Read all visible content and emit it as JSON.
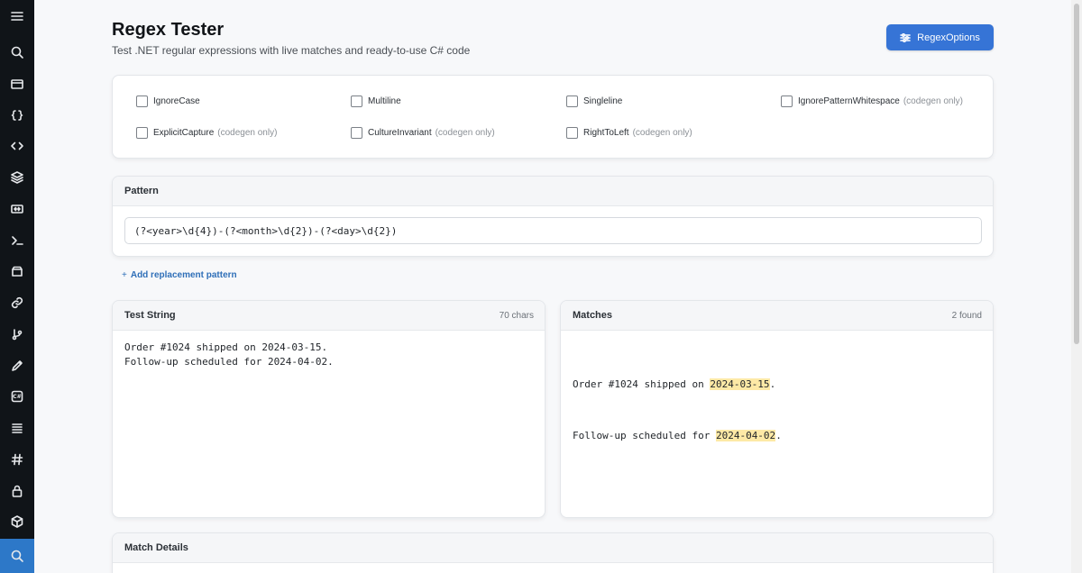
{
  "sidebar": {
    "icons": [
      "menu-icon",
      "search-icon",
      "credit-card-icon",
      "braces-icon",
      "code-icon",
      "layers-icon",
      "compare-icon",
      "terminal-icon",
      "archive-icon",
      "link-icon",
      "git-icon",
      "pen-icon",
      "csharp-icon",
      "list-icon",
      "hash-icon",
      "lock-icon",
      "package-icon",
      "search-active-icon"
    ],
    "csharp_label": "C#",
    "active": "search-active-icon"
  },
  "header": {
    "title": "Regex Tester",
    "subtitle": "Test .NET regular expressions with live matches and ready-to-use C# code",
    "options_button": "RegexOptions"
  },
  "options": {
    "items": [
      {
        "label": "IgnoreCase",
        "note": "",
        "checked": false
      },
      {
        "label": "Multiline",
        "note": "",
        "checked": false
      },
      {
        "label": "Singleline",
        "note": "",
        "checked": false
      },
      {
        "label": "IgnorePatternWhitespace",
        "note": "(codegen only)",
        "checked": false
      },
      {
        "label": "ExplicitCapture",
        "note": "(codegen only)",
        "checked": false
      },
      {
        "label": "CultureInvariant",
        "note": "(codegen only)",
        "checked": false
      },
      {
        "label": "RightToLeft",
        "note": "(codegen only)",
        "checked": false
      }
    ]
  },
  "pattern": {
    "heading": "Pattern",
    "value": "(?<year>\\d{4})-(?<month>\\d{2})-(?<day>\\d{2})"
  },
  "add_replacement": {
    "plus": "+",
    "label": "Add replacement pattern"
  },
  "test_string": {
    "heading": "Test String",
    "count": "70 chars",
    "lines": [
      "Order #1024 shipped on 2024-03-15.",
      "Follow-up scheduled for 2024-04-02."
    ]
  },
  "matches": {
    "heading": "Matches",
    "count": "2 found",
    "lines": [
      {
        "before": "Order #1024 shipped on ",
        "match": "2024-03-15",
        "after": "."
      },
      {
        "before": "Follow-up scheduled for ",
        "match": "2024-04-02",
        "after": "."
      }
    ],
    "highlight_color": "#fde9a6"
  },
  "match_details": {
    "heading": "Match Details"
  },
  "colors": {
    "accent": "#3674d6",
    "sidebar": "#101418",
    "sidebar_active": "#2d78c8"
  }
}
